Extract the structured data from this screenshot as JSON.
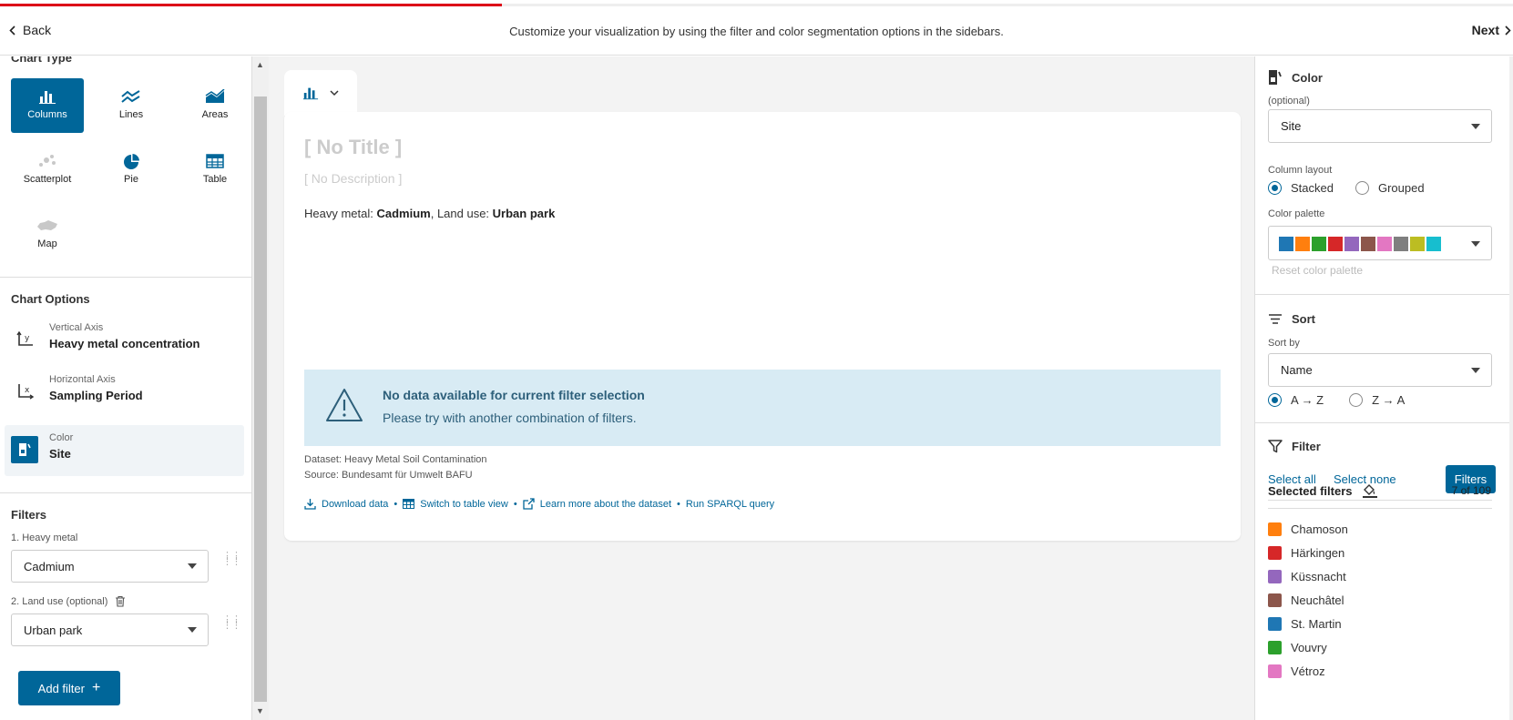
{
  "topbar": {
    "back_label": "Back",
    "message": "Customize your visualization by using the filter and color segmentation options in the sidebars.",
    "next_label": "Next"
  },
  "left": {
    "chart_type_title": "Chart Type",
    "chart_types": [
      {
        "label": "Columns",
        "icon": "columns-icon",
        "active": true
      },
      {
        "label": "Lines",
        "icon": "lines-icon",
        "active": false
      },
      {
        "label": "Areas",
        "icon": "areas-icon",
        "active": false
      },
      {
        "label": "Scatterplot",
        "icon": "scatterplot-icon",
        "active": false
      },
      {
        "label": "Pie",
        "icon": "pie-icon",
        "active": false
      },
      {
        "label": "Table",
        "icon": "table-icon",
        "active": false
      },
      {
        "label": "Map",
        "icon": "map-icon",
        "active": false
      }
    ],
    "chart_options_title": "Chart Options",
    "options": [
      {
        "sub": "Vertical Axis",
        "value": "Heavy metal concentration",
        "icon": "y-axis-icon"
      },
      {
        "sub": "Horizontal Axis",
        "value": "Sampling Period",
        "icon": "x-axis-icon"
      },
      {
        "sub": "Color",
        "value": "Site",
        "icon": "color-segment-icon"
      }
    ],
    "filters_title": "Filters",
    "filters": [
      {
        "label": "1. Heavy metal",
        "value": "Cadmium"
      },
      {
        "label": "2. Land use (optional)",
        "value": "Urban park"
      }
    ],
    "add_filter_label": "Add filter"
  },
  "center": {
    "no_title": "[ No Title ]",
    "no_description": "[ No Description ]",
    "filter_summary": {
      "k1": "Heavy metal: ",
      "v1": "Cadmium",
      "sep": ", Land use: ",
      "v2": "Urban park"
    },
    "alert_title": "No data available for current filter selection",
    "alert_text": "Please try with another combination of filters.",
    "dataset_line": "Dataset: Heavy Metal Soil Contamination",
    "source_line": "Source: Bundesamt für Umwelt BAFU",
    "links": {
      "download": "Download data",
      "table_view": "Switch to table view",
      "learn_more": "Learn more about the dataset",
      "sparql": "Run SPARQL query"
    }
  },
  "right": {
    "color_title": "Color",
    "optional": "(optional)",
    "color_select": "Site",
    "column_layout_label": "Column layout",
    "layout_stacked": "Stacked",
    "layout_grouped": "Grouped",
    "color_palette_label": "Color palette",
    "palette": [
      "#1f77b4",
      "#ff7f0e",
      "#2ca02c",
      "#d62728",
      "#9467bd",
      "#8c564b",
      "#e377c2",
      "#7f7f7f",
      "#bcbd22",
      "#17becf"
    ],
    "reset_palette": "Reset color palette",
    "sort_title": "Sort",
    "sort_by_label": "Sort by",
    "sort_select": "Name",
    "sort_az": "A → Z",
    "sort_za": "Z → A",
    "filter_title": "Filter",
    "select_all": "Select all",
    "select_none": "Select none",
    "filters_button": "Filters",
    "selected_filters": "Selected filters",
    "selected_count": "7 of 109",
    "sites": [
      {
        "name": "Chamoson",
        "color": "#ff7f0e"
      },
      {
        "name": "Härkingen",
        "color": "#d62728"
      },
      {
        "name": "Küssnacht",
        "color": "#9467bd"
      },
      {
        "name": "Neuchâtel",
        "color": "#8c564b"
      },
      {
        "name": "St. Martin",
        "color": "#1f77b4"
      },
      {
        "name": "Vouvry",
        "color": "#2ca02c"
      },
      {
        "name": "Vétroz",
        "color": "#e377c2"
      }
    ]
  },
  "colors": {
    "accent": "#006699",
    "progress": "#dc0018",
    "alert_bg": "#d8ebf4"
  }
}
